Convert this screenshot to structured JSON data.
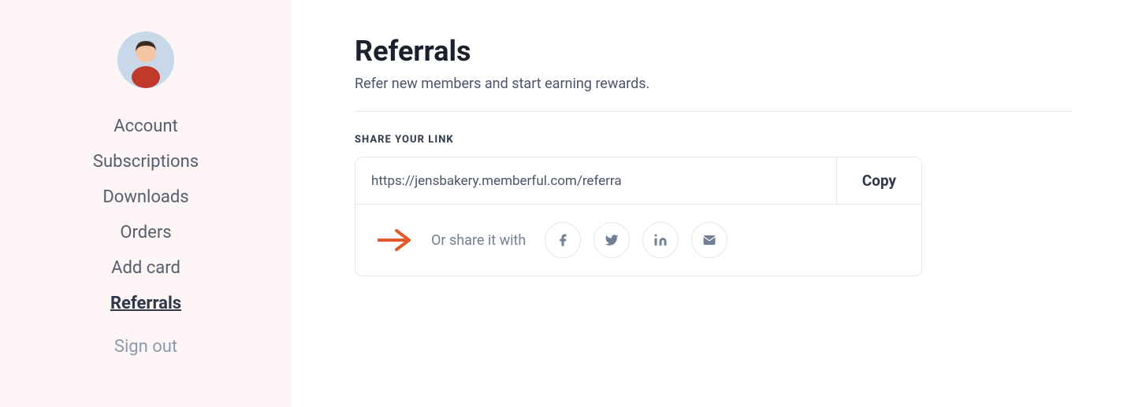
{
  "sidebar": {
    "avatar_alt": "User avatar",
    "nav_items": [
      {
        "label": "Account",
        "href": "#account",
        "active": false
      },
      {
        "label": "Subscriptions",
        "href": "#subscriptions",
        "active": false
      },
      {
        "label": "Downloads",
        "href": "#downloads",
        "active": false
      },
      {
        "label": "Orders",
        "href": "#orders",
        "active": false
      },
      {
        "label": "Add card",
        "href": "#add-card",
        "active": false
      },
      {
        "label": "Referrals",
        "href": "#referrals",
        "active": true
      }
    ],
    "signout_label": "Sign out"
  },
  "main": {
    "title": "Referrals",
    "subtitle": "Refer new members and start earning rewards.",
    "section_label": "SHARE YOUR LINK",
    "referral_url": "https://jensbakery.memberful.com/referra",
    "copy_label": "Copy",
    "share_text": "Or share it with",
    "social_buttons": [
      {
        "name": "facebook",
        "label": "f"
      },
      {
        "name": "twitter",
        "label": "t"
      },
      {
        "name": "linkedin",
        "label": "in"
      },
      {
        "name": "email",
        "label": "✉"
      }
    ]
  }
}
